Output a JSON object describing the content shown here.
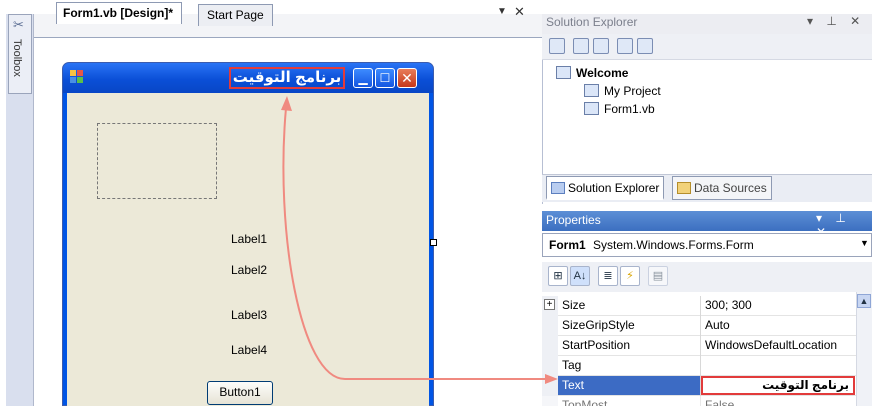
{
  "toolbox": {
    "label": "Toolbox"
  },
  "designer": {
    "tabs": [
      {
        "label": "Form1.vb [Design]*"
      },
      {
        "label": "Start Page"
      }
    ],
    "dropdown_glyph": "▼",
    "close_glyph": "✕",
    "form": {
      "title": "برنامج التوقيت",
      "labels": [
        "Label1",
        "Label2",
        "Label3",
        "Label4"
      ],
      "button_label": "Button1"
    }
  },
  "solution_explorer": {
    "title": "Solution Explorer",
    "controls": "▾ ⊥ ✕",
    "tree": [
      {
        "label": "Welcome",
        "bold": true
      },
      {
        "label": "My Project"
      },
      {
        "label": "Form1.vb"
      }
    ],
    "bottom_tabs": [
      "Solution Explorer",
      "Data Sources"
    ]
  },
  "properties": {
    "title": "Properties",
    "controls": "▾ ⊥ ✕",
    "object_name": "Form1",
    "object_type": "System.Windows.Forms.Form",
    "rows": [
      {
        "name": "Size",
        "value": "300; 300",
        "expandable": true
      },
      {
        "name": "SizeGripStyle",
        "value": "Auto"
      },
      {
        "name": "StartPosition",
        "value": "WindowsDefaultLocation"
      },
      {
        "name": "Tag",
        "value": ""
      },
      {
        "name": "Text",
        "value": "برنامج التوقيت",
        "selected": true
      },
      {
        "name": "TopMost",
        "value": "False"
      }
    ]
  },
  "colors": {
    "highlight_box": "#e23b3b",
    "arrow": "#f08a80",
    "selection": "#3c6bc4",
    "titlebar": "#0b4fd7"
  }
}
